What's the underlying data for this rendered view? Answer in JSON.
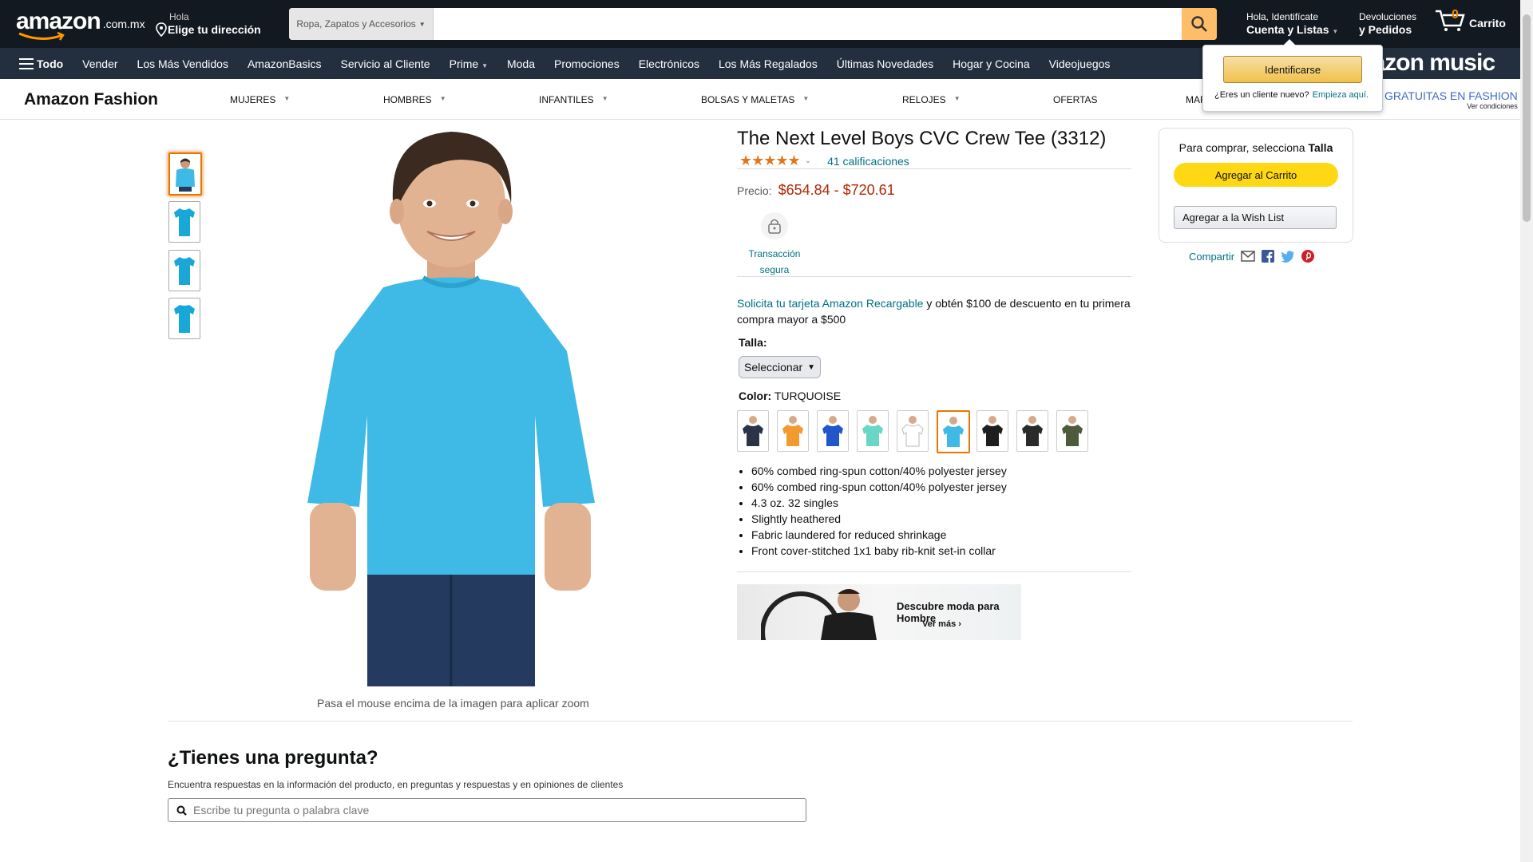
{
  "header": {
    "logo_text": "amazon",
    "logo_tld": ".com.mx",
    "address_line1": "Hola",
    "address_line2": "Elige tu dirección",
    "search_category": "Ropa, Zapatos y Accesorios",
    "search_value": "",
    "account_line1": "Hola, Identifícate",
    "account_line2": "Cuenta y Listas",
    "returns_line1": "Devoluciones",
    "returns_line2": "y Pedidos",
    "cart_count": "0",
    "cart_label": "Carrito"
  },
  "nav": {
    "all_label": "Todo",
    "items": [
      "Vender",
      "Los Más Vendidos",
      "AmazonBasics",
      "Servicio al Cliente",
      "Prime",
      "Moda",
      "Promociones",
      "Electrónicos",
      "Los Más Regalados",
      "Últimas Novedades",
      "Hogar y Cocina",
      "Videojuegos"
    ],
    "promo": "amazon music"
  },
  "fashion_nav": {
    "title": "Amazon Fashion",
    "items": [
      "MUJERES",
      "HOMBRES",
      "INFANTILES",
      "BOLSAS Y MALETAS",
      "RELOJES",
      "OFERTAS",
      "MAR"
    ],
    "promo_text": "GRATUITAS EN FASHION",
    "promo_small": "Ver condiciones"
  },
  "signin_popup": {
    "button": "Identificarse",
    "new_customer": "¿Eres un cliente nuevo?",
    "start_link": "Empieza aquí."
  },
  "product": {
    "title": "The Next Level Boys CVC Crew Tee (3312)",
    "rating_stars": "★★★★★",
    "rating_value": 4.5,
    "ratings_count": "41 calificaciones",
    "price_label": "Precio:",
    "price": "$654.84 - $720.61",
    "secure_line1": "Transacción",
    "secure_line2": "segura",
    "card_link": "Solicita tu tarjeta Amazon Recargable",
    "card_text": " y obtén $100 de descuento en tu primera compra mayor a $500",
    "size_label": "Talla:",
    "size_select": "Seleccionar",
    "color_label": "Color:",
    "color_value": "TURQUOISE",
    "swatch_colors": [
      "#2b3447",
      "#f29a2e",
      "#2157c9",
      "#6ad7c6",
      "#ffffff",
      "#3fb9e6",
      "#1e1e1e",
      "#2a2a2a",
      "#4d5b3a"
    ],
    "bullets": [
      "60% combed ring-spun cotton/40% polyester jersey",
      "60% combed ring-spun cotton/40% polyester jersey",
      "4.3 oz. 32 singles",
      "Slightly heathered",
      "Fabric laundered for reduced shrinkage",
      "Front cover-stitched 1x1 baby rib-knit set-in collar"
    ],
    "zoom_note": "Pasa el mouse encima de la imagen para aplicar zoom",
    "banner_title": "Descubre moda para Hombre",
    "banner_link": "Ver más ›"
  },
  "buybox": {
    "prompt": "Para comprar, selecciona ",
    "prompt_bold": "Talla",
    "add_to_cart": "Agregar al Carrito",
    "wishlist": "Agregar a la Wish List",
    "share": "Compartir"
  },
  "questions": {
    "title": "¿Tienes una pregunta?",
    "subtitle": "Encuentra respuestas en la información del producto, en preguntas y respuestas y en opiniones de clientes",
    "placeholder": "Escribe tu pregunta o palabra clave"
  },
  "colors": {
    "topbar": "#131921",
    "navbar": "#232f3e",
    "price": "#b12704",
    "link": "#007185",
    "tee": "#3fb9e6"
  }
}
